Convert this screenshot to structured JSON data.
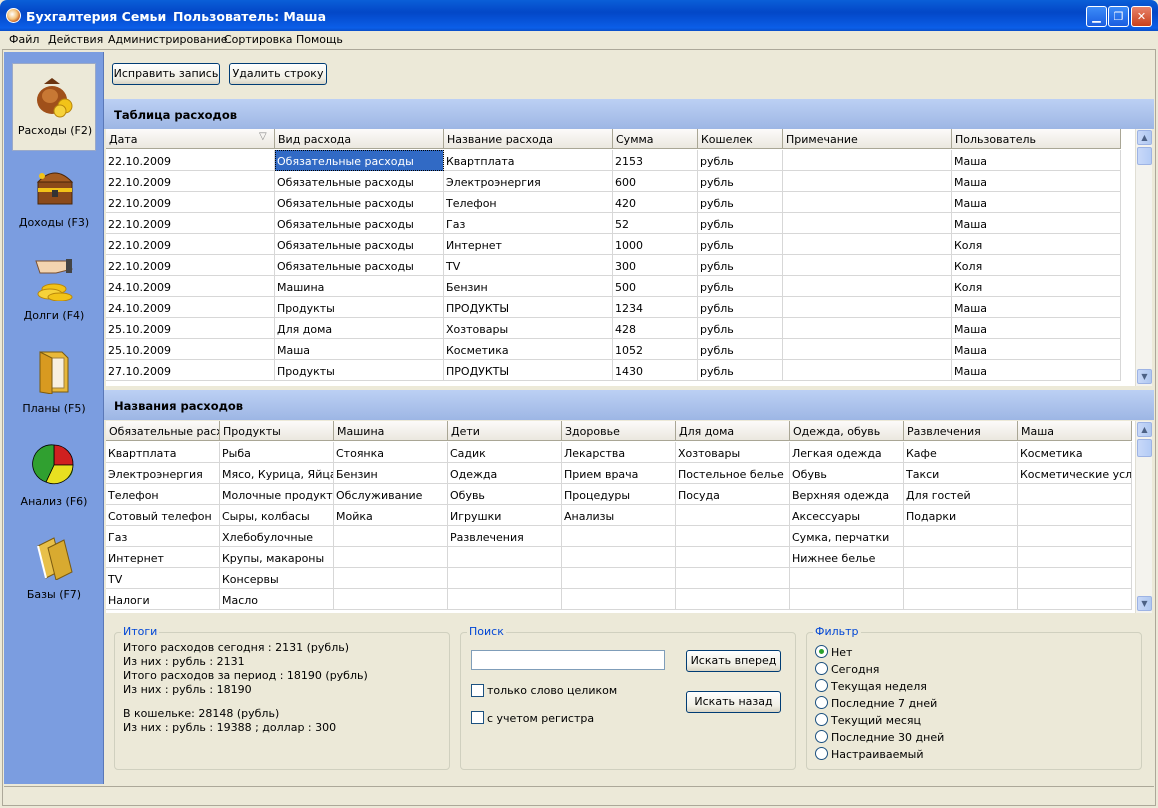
{
  "window": {
    "title": "Бухгалтерия Семьи",
    "user": "Пользователь: Маша"
  },
  "menu": [
    "Файл",
    "Действия",
    "Администрирование",
    "Сортировка",
    "Помощь"
  ],
  "nav": [
    {
      "label": "Расходы (F2)",
      "icon": "money-bag-icon"
    },
    {
      "label": "Доходы (F3)",
      "icon": "treasure-chest-icon"
    },
    {
      "label": "Долги (F4)",
      "icon": "hand-coins-icon"
    },
    {
      "label": "Планы (F5)",
      "icon": "folder-icon"
    },
    {
      "label": "Анализ (F6)",
      "icon": "pie-chart-icon"
    },
    {
      "label": "Базы (F7)",
      "icon": "binders-icon"
    }
  ],
  "toolbar": {
    "edit": "Исправить запись",
    "delete": "Удалить строку"
  },
  "expenses": {
    "title": "Таблица расходов",
    "columns": [
      "Дата",
      "Вид расхода",
      "Название расхода",
      "Сумма",
      "Кошелек",
      "Примечание",
      "Пользователь"
    ],
    "rows": [
      [
        "22.10.2009",
        "Обязательные расходы",
        "Квартплата",
        "2153",
        "рубль",
        "",
        "Маша"
      ],
      [
        "22.10.2009",
        "Обязательные расходы",
        "Электроэнергия",
        "600",
        "рубль",
        "",
        "Маша"
      ],
      [
        "22.10.2009",
        "Обязательные расходы",
        "Телефон",
        "420",
        "рубль",
        "",
        "Маша"
      ],
      [
        "22.10.2009",
        "Обязательные расходы",
        "Газ",
        "52",
        "рубль",
        "",
        "Маша"
      ],
      [
        "22.10.2009",
        "Обязательные расходы",
        "Интернет",
        "1000",
        "рубль",
        "",
        "Коля"
      ],
      [
        "22.10.2009",
        "Обязательные расходы",
        "TV",
        "300",
        "рубль",
        "",
        "Коля"
      ],
      [
        "24.10.2009",
        "Машина",
        "Бензин",
        "500",
        "рубль",
        "",
        "Коля"
      ],
      [
        "24.10.2009",
        "Продукты",
        "ПРОДУКТЫ",
        "1234",
        "рубль",
        "",
        "Маша"
      ],
      [
        "25.10.2009",
        "Для дома",
        "Хозтовары",
        "428",
        "рубль",
        "",
        "Маша"
      ],
      [
        "25.10.2009",
        "Маша",
        "Косметика",
        "1052",
        "рубль",
        "",
        "Маша"
      ],
      [
        "27.10.2009",
        "Продукты",
        "ПРОДУКТЫ",
        "1430",
        "рубль",
        "",
        "Маша"
      ]
    ]
  },
  "names": {
    "title": "Названия расходов",
    "columns": [
      "Обязательные расходы",
      "Продукты",
      "Машина",
      "Дети",
      "Здоровье",
      "Для дома",
      "Одежда, обувь",
      "Развлечения",
      "Маша"
    ],
    "rows": [
      [
        "Квартплата",
        "Рыба",
        "Стоянка",
        "Садик",
        "Лекарства",
        "Хозтовары",
        "Легкая одежда",
        "Кафе",
        "Косметика"
      ],
      [
        "Электроэнергия",
        "Мясо, Курица, Яйца",
        "Бензин",
        "Одежда",
        "Прием врача",
        "Постельное белье",
        "Обувь",
        "Такси",
        "Косметические услуги"
      ],
      [
        "Телефон",
        "Молочные продукты",
        "Обслуживание",
        "Обувь",
        "Процедуры",
        "Посуда",
        "Верхняя одежда",
        "Для гостей",
        ""
      ],
      [
        "Сотовый телефон",
        "Сыры, колбасы",
        "Мойка",
        "Игрушки",
        "Анализы",
        "",
        "Аксессуары",
        "Подарки",
        ""
      ],
      [
        "Газ",
        "Хлебобулочные",
        "",
        "Развлечения",
        "",
        "",
        "Сумка, перчатки",
        "",
        ""
      ],
      [
        "Интернет",
        "Крупы, макароны",
        "",
        "",
        "",
        "",
        "Нижнее белье",
        "",
        ""
      ],
      [
        "TV",
        "Консервы",
        "",
        "",
        "",
        "",
        "",
        "",
        ""
      ],
      [
        "Налоги",
        "Масло",
        "",
        "",
        "",
        "",
        "",
        "",
        ""
      ]
    ]
  },
  "totals": {
    "legend": "Итоги",
    "lines": [
      "Итого расходов сегодня : 2131 (рубль)",
      "Из них : рубль : 2131",
      "Итого расходов за период : 18190 (рубль)",
      "Из них : рубль : 18190",
      "",
      "В кошельке: 28148 (рубль)",
      "Из них : рубль : 19388 ; доллар : 300"
    ]
  },
  "search": {
    "legend": "Поиск",
    "value": "",
    "forward": "Искать вперед",
    "back": "Искать назад",
    "whole_word": "только слово целиком",
    "match_case": "с учетом регистра"
  },
  "filter": {
    "legend": "Фильтр",
    "options": [
      "Нет",
      "Сегодня",
      "Текущая неделя",
      "Последние 7 дней",
      "Текущий месяц",
      "Последние 30 дней",
      "Настраиваемый"
    ],
    "selected": "Нет"
  }
}
